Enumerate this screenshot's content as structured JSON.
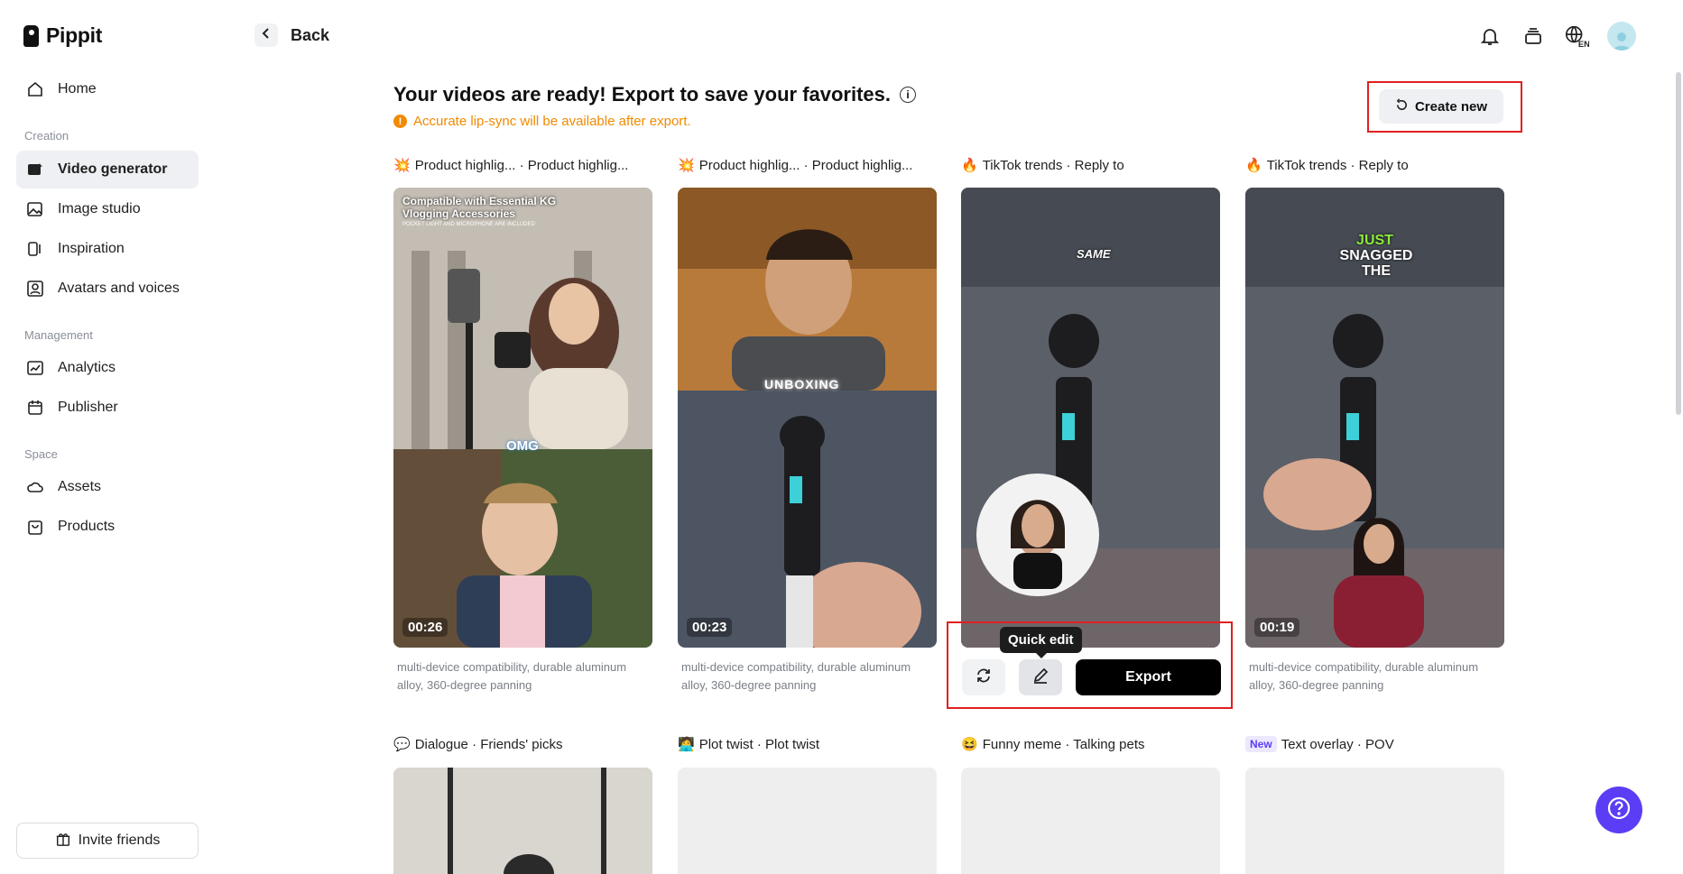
{
  "app": {
    "name": "Pippit"
  },
  "sidebar": {
    "items_top": [
      {
        "label": "Home",
        "icon": "home-icon"
      }
    ],
    "sections": [
      {
        "label": "Creation",
        "items": [
          {
            "label": "Video generator",
            "icon": "video-generator-icon",
            "active": true
          },
          {
            "label": "Image studio",
            "icon": "image-studio-icon"
          },
          {
            "label": "Inspiration",
            "icon": "inspiration-icon"
          },
          {
            "label": "Avatars and voices",
            "icon": "avatar-voice-icon"
          }
        ]
      },
      {
        "label": "Management",
        "items": [
          {
            "label": "Analytics",
            "icon": "analytics-icon"
          },
          {
            "label": "Publisher",
            "icon": "calendar-icon"
          }
        ]
      },
      {
        "label": "Space",
        "items": [
          {
            "label": "Assets",
            "icon": "cloud-icon"
          },
          {
            "label": "Products",
            "icon": "bag-icon"
          }
        ]
      }
    ],
    "invite_label": "Invite friends"
  },
  "header": {
    "back_label": "Back"
  },
  "main": {
    "title": "Your videos are ready! Export to save your favorites.",
    "warning": "Accurate lip-sync will be available after export.",
    "create_new_label": "Create new",
    "cards_row1": [
      {
        "emoji": "💥",
        "title": "Product highlig... · Product highlig...",
        "duration": "00:26",
        "desc": "multi-device compatibility, durable aluminum alloy, 360-degree panning",
        "overlay_text": "Compatible with Essential KG Vlogging Accessories",
        "overlay_sub": "POCKET LIGHT AND MICROPHONE ARE INCLUDED",
        "caption": "OMG"
      },
      {
        "emoji": "💥",
        "title": "Product highlig... · Product highlig...",
        "duration": "00:23",
        "desc": "multi-device compatibility, durable aluminum alloy, 360-degree panning",
        "caption": "UNBOXING"
      },
      {
        "emoji": "🔥",
        "title": "TikTok trends · Reply to",
        "duration": "",
        "desc": "",
        "caption": "SAME"
      },
      {
        "emoji": "🔥",
        "title": "TikTok trends · Reply to",
        "duration": "00:19",
        "desc": "multi-device compatibility, durable aluminum alloy, 360-degree panning",
        "caption_green": "JUST",
        "caption": "SNAGGED THE"
      }
    ],
    "cards_row2": [
      {
        "emoji": "💬",
        "title": "Dialogue · Friends' picks"
      },
      {
        "emoji": "🧑‍💻",
        "title": "Plot twist · Plot twist"
      },
      {
        "emoji": "😆",
        "title": "Funny meme · Talking pets"
      },
      {
        "badge": "New",
        "title": "Text overlay · POV"
      }
    ],
    "hover_actions": {
      "tooltip": "Quick edit",
      "export_label": "Export"
    }
  },
  "colors": {
    "accent": "#5b3df5",
    "warning": "#f08a00",
    "highlight": "#e02020"
  }
}
